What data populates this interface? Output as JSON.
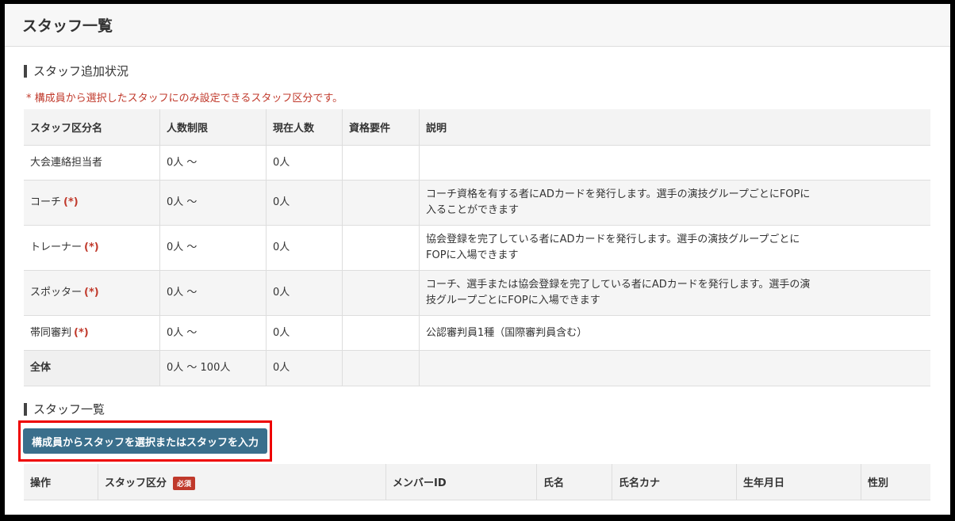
{
  "page": {
    "title": "スタッフ一覧"
  },
  "limits_section": {
    "title": "スタッフ追加状況",
    "note": "* 構成員から選択したスタッフにのみ設定できるスタッフ区分です。",
    "headers": [
      "スタッフ区分名",
      "人数制限",
      "現在人数",
      "資格要件",
      "説明"
    ],
    "rows": [
      {
        "name": "大会連絡担当者",
        "req": "",
        "limit": "0人 〜",
        "current": "0人",
        "qual": "",
        "desc": "",
        "h": 44
      },
      {
        "name": "コーチ",
        "req": "(*)",
        "limit": "0人 〜",
        "current": "0人",
        "qual": "",
        "desc": "コーチ資格を有する者にADカードを発行します。選手の演技グループごとにFOPに入ることができます"
      },
      {
        "name": "トレーナー",
        "req": "(*)",
        "limit": "0人 〜",
        "current": "0人",
        "qual": "",
        "desc": "協会登録を完了している者にADカードを発行します。選手の演技グループごとにFOPに入場できます"
      },
      {
        "name": "スポッター",
        "req": "(*)",
        "limit": "0人 〜",
        "current": "0人",
        "qual": "",
        "desc": "コーチ、選手または協会登録を完了している者にADカードを発行します。選手の演技グループごとにFOPに入場できます"
      },
      {
        "name": "帯同審判",
        "req": "(*)",
        "limit": "0人 〜",
        "current": "0人",
        "qual": "",
        "desc": "公認審判員1種（国際審判員含む）"
      }
    ],
    "total": {
      "name": "全体",
      "limit": "0人 〜 100人",
      "current": "0人",
      "qual": "",
      "desc": ""
    }
  },
  "staff_section": {
    "title": "スタッフ一覧",
    "select_button": "構成員からスタッフを選択またはスタッフを入力",
    "headers": [
      "操作",
      "スタッフ区分",
      "メンバーID",
      "氏名",
      "氏名カナ",
      "生年月日",
      "性別"
    ],
    "required_badge": "必須"
  }
}
